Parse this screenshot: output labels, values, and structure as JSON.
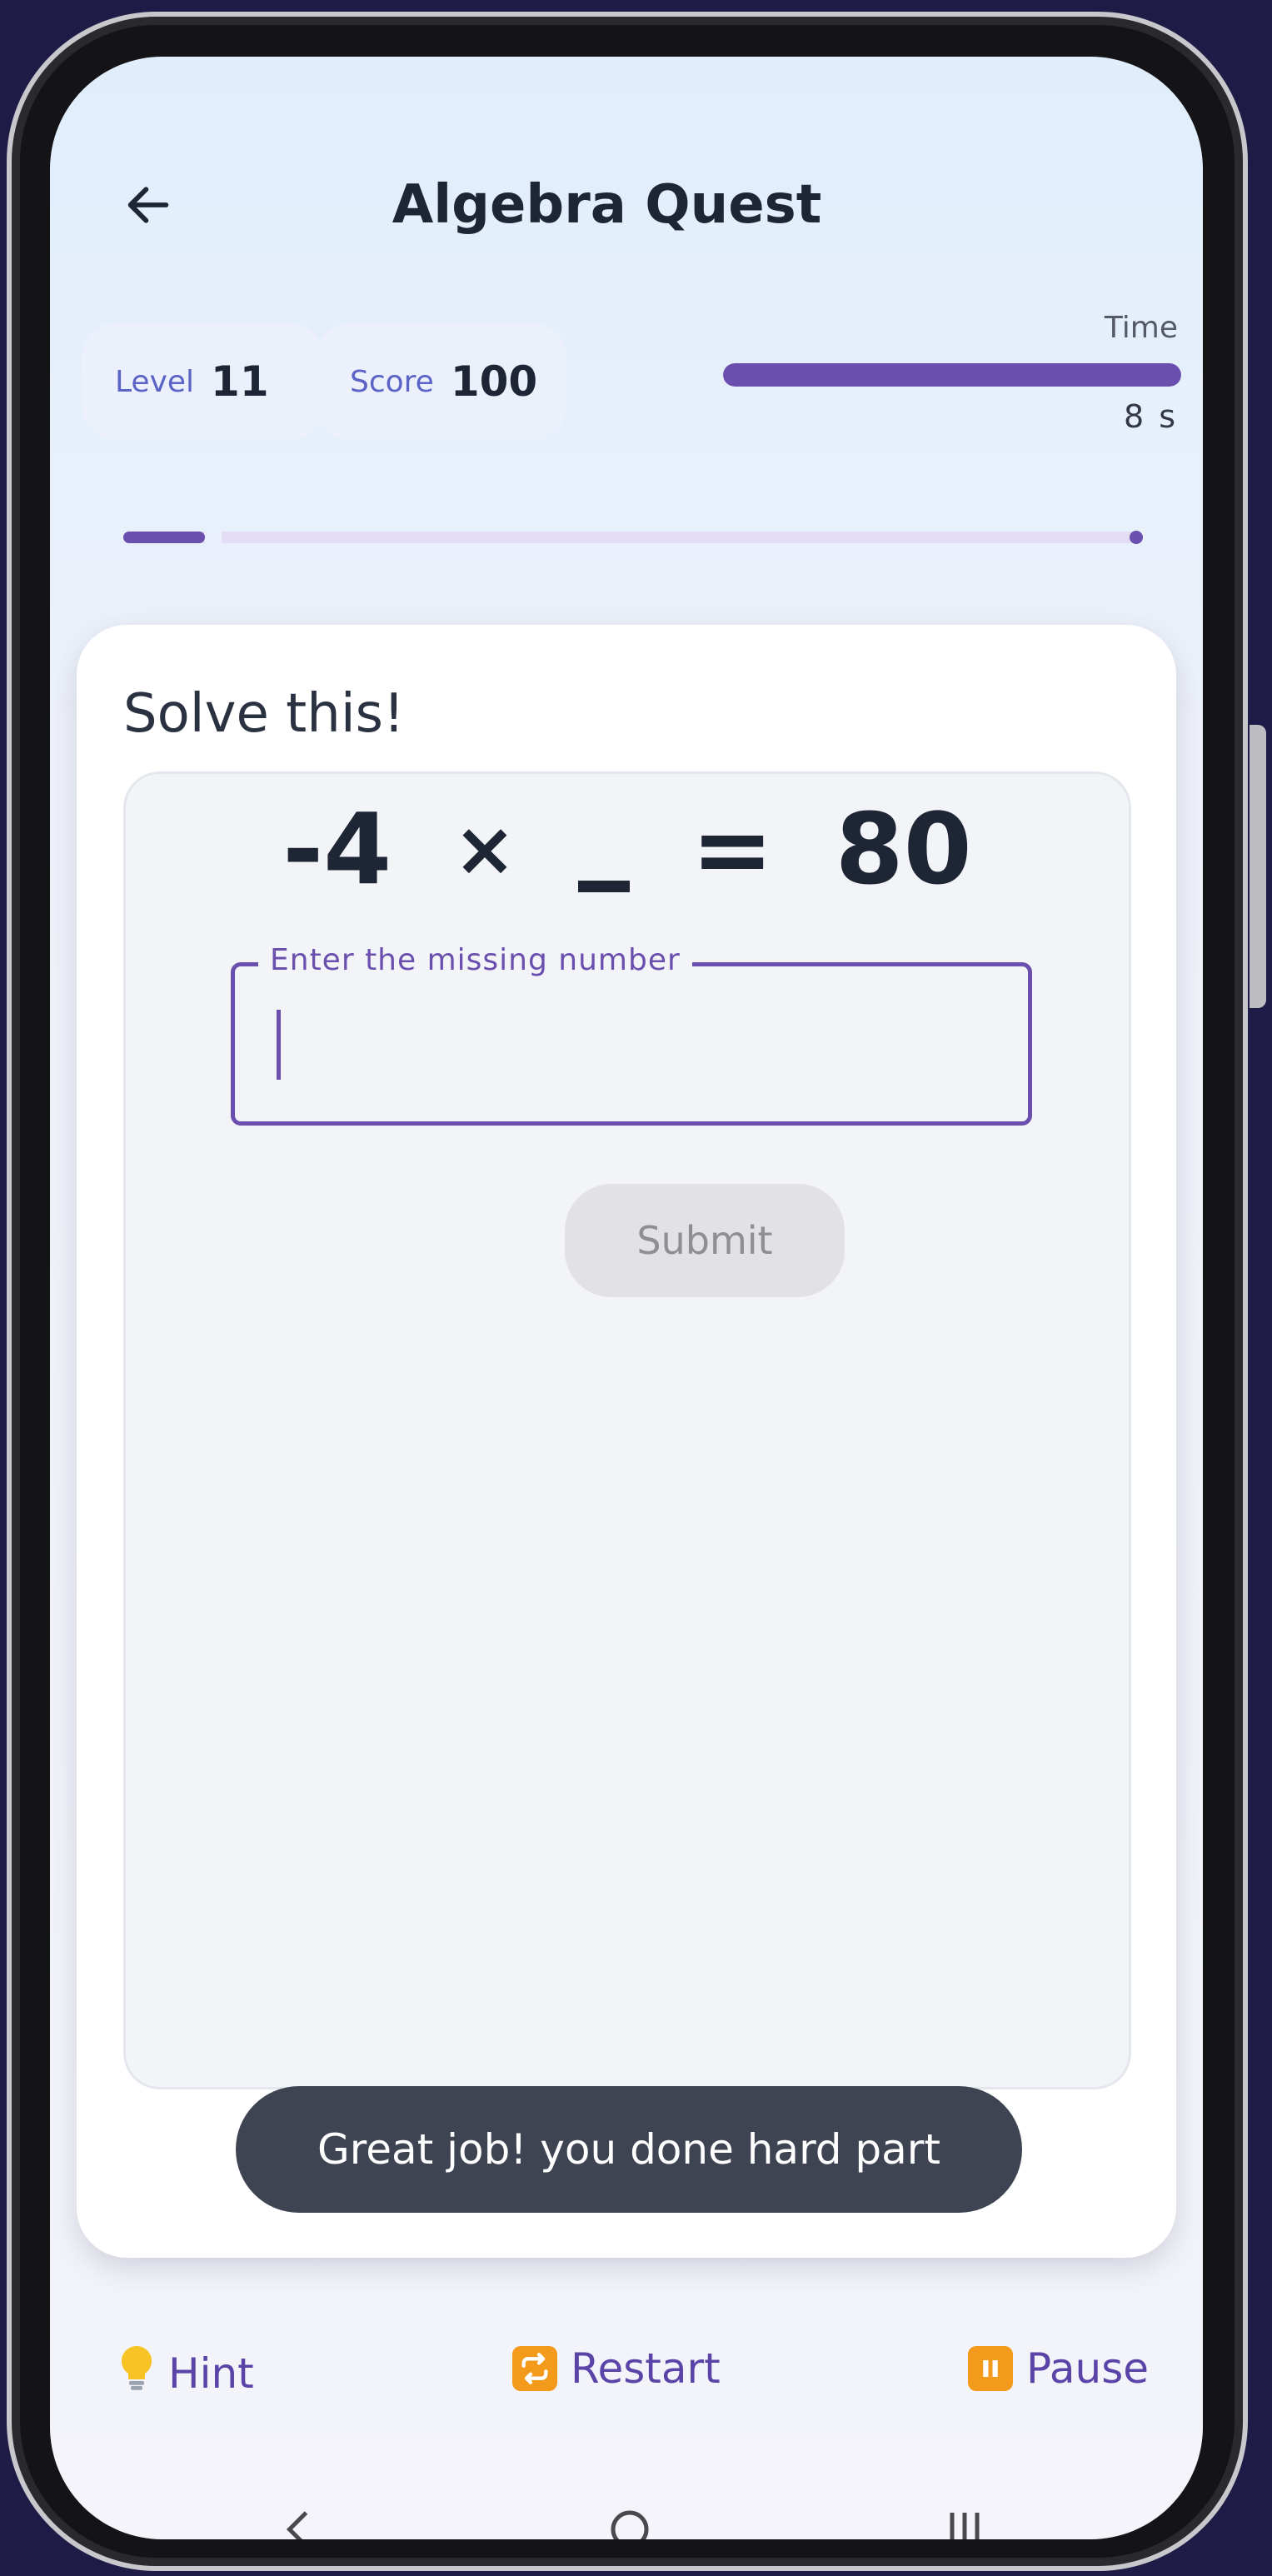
{
  "header": {
    "title": "Algebra Quest",
    "back_icon": "arrow-left-icon"
  },
  "stats": {
    "level_label": "Level",
    "level_value": "11",
    "score_label": "Score",
    "score_value": "100"
  },
  "timer": {
    "label": "Time",
    "value_text": "8 s",
    "remaining_fraction": 1.0
  },
  "level_progress": {
    "fraction": 0.08
  },
  "card": {
    "heading": "Solve this!",
    "equation": {
      "left": "-4",
      "operator": "×",
      "blank": "_",
      "equals": "=",
      "right": "80"
    },
    "input": {
      "label": "Enter the missing number",
      "value": ""
    },
    "submit_label": "Submit"
  },
  "toast": {
    "message": "Great job! you done hard part"
  },
  "actions": {
    "hint_label": "Hint",
    "restart_label": "Restart",
    "pause_label": "Pause",
    "hint_icon": "lightbulb-icon",
    "restart_icon": "repeat-icon",
    "pause_icon": "pause-icon"
  },
  "colors": {
    "accent": "#6a4fae",
    "toast_bg": "#3f4452",
    "action_text": "#5a44a8",
    "stat_label": "#5b63c6"
  }
}
